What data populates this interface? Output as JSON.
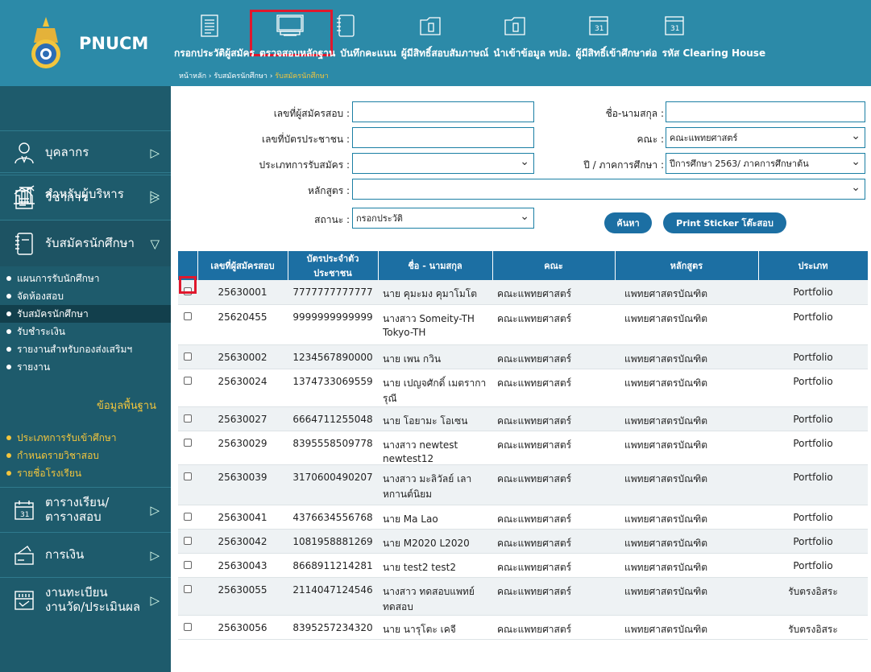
{
  "brand": {
    "name": "PNUCM"
  },
  "sidebar": {
    "menu": [
      {
        "label": "สำหรับผู้บริหาร",
        "icon": "chart-icon"
      },
      {
        "label": "บุคลากร",
        "icon": "person-icon"
      },
      {
        "label": "วิชาการ",
        "icon": "document-icon"
      },
      {
        "label": "รับสมัครนักศึกษา",
        "icon": "notebook-icon"
      }
    ],
    "admission_sub": [
      "แผนการรับนักศึกษา",
      "จัดห้องสอบ",
      "รับสมัครนักศึกษา",
      "รับชำระเงิน",
      "รายงานสำหรับกองส่งเสริมฯ",
      "รายงาน"
    ],
    "master_title": "ข้อมูลพื้นฐาน",
    "master_sub": [
      "ประเภทการรับเข้าศึกษา",
      "กำหนดรายวิชาสอบ",
      "รายชื่อโรงเรียน"
    ],
    "schedule": {
      "line1": "ตารางเรียน/",
      "line2": "ตารางสอบ"
    },
    "finance": "การเงิน",
    "registration": {
      "line1": "งานทะเบียน",
      "line2": "งานวัด/ประเมินผล"
    }
  },
  "topnav": {
    "items": [
      "กรอกประวัติผู้สมัคร",
      "ตรวจสอบหลักฐาน",
      "บันทึกคะแนน",
      "ผู้มีสิทธิ์สอบสัมภาษณ์",
      "นำเข้าข้อมูล ทปอ.",
      "ผู้มีสิทธิ์เข้าศึกษาต่อ",
      "รหัส Clearing House"
    ],
    "breadcrumb": {
      "home": "หน้าหลัก",
      "sep": " › ",
      "level1": "รับสมัครนักศึกษา",
      "current": "รับสมัครนักศึกษา"
    }
  },
  "form": {
    "applicant_no_label": "เลขที่ผู้สมัครสอบ :",
    "name_label": "ชื่อ-นามสกุล :",
    "id_card_label": "เลขที่บัตรประชาชน :",
    "faculty_label": "คณะ :",
    "faculty_value": "คณะแพทยศาสตร์",
    "admission_type_label": "ประเภทการรับสมัคร :",
    "year_label": "ปี / ภาคการศึกษา :",
    "year_value": "ปีการศึกษา 2563/ ภาคการศึกษาต้น",
    "curriculum_label": "หลักสูตร :",
    "status_label": "สถานะ :",
    "status_value": "กรอกประวัติ",
    "search_button": "ค้นหา",
    "sticker_button": "Print Sticker โต๊ะสอบ"
  },
  "table": {
    "headers": [
      "",
      "เลขที่ผู้สมัครสอบ",
      "บัตรประจำตัวประชาชน",
      "ชื่อ - นามสกุล",
      "คณะ",
      "หลักสูตร",
      "ประเภท"
    ],
    "rows": [
      [
        "25630001",
        "7777777777777",
        "นาย คุมะมง คุมาโมโต",
        "คณะแพทยศาสตร์",
        "แพทยศาสตรบัณฑิต",
        "Portfolio"
      ],
      [
        "25620455",
        "9999999999999",
        "นางสาว Someity-TH Tokyo-TH",
        "คณะแพทยศาสตร์",
        "แพทยศาสตรบัณฑิต",
        "Portfolio"
      ],
      [
        "25630002",
        "1234567890000",
        "นาย เพน กวิน",
        "คณะแพทยศาสตร์",
        "แพทยศาสตรบัณฑิต",
        "Portfolio"
      ],
      [
        "25630024",
        "1374733069559",
        "นาย เปญจศักดิ์ เมตราการุณี",
        "คณะแพทยศาสตร์",
        "แพทยศาสตรบัณฑิต",
        "Portfolio"
      ],
      [
        "25630027",
        "6664711255048",
        "นาย โอยามะ โอเซน",
        "คณะแพทยศาสตร์",
        "แพทยศาสตรบัณฑิต",
        "Portfolio"
      ],
      [
        "25630029",
        "8395558509778",
        "นางสาว newtest newtest12",
        "คณะแพทยศาสตร์",
        "แพทยศาสตรบัณฑิต",
        "Portfolio"
      ],
      [
        "25630039",
        "3170600490207",
        "นางสาว มะลิวัลย์ เลาหกานต์นิยม",
        "คณะแพทยศาสตร์",
        "แพทยศาสตรบัณฑิต",
        "Portfolio"
      ],
      [
        "25630041",
        "4376634556768",
        "นาย Ma Lao",
        "คณะแพทยศาสตร์",
        "แพทยศาสตรบัณฑิต",
        "Portfolio"
      ],
      [
        "25630042",
        "1081958881269",
        "นาย M2020 L2020",
        "คณะแพทยศาสตร์",
        "แพทยศาสตรบัณฑิต",
        "Portfolio"
      ],
      [
        "25630043",
        "8668911214281",
        "นาย test2 test2",
        "คณะแพทยศาสตร์",
        "แพทยศาสตรบัณฑิต",
        "Portfolio"
      ],
      [
        "25630055",
        "2114047124546",
        "นางสาว ทดสอบแพทย์ ทดสอบ",
        "คณะแพทยศาสตร์",
        "แพทยศาสตรบัณฑิต",
        "รับตรงอิสระ"
      ],
      [
        "25630056",
        "8395257234320",
        "นาย นารุโตะ เคจี",
        "คณะแพทยศาสตร์",
        "แพทยศาสตรบัณฑิต",
        "รับตรงอิสระ"
      ]
    ]
  },
  "colors": {
    "sidebar": "#1e5b6c",
    "header": "#2c8aa8",
    "accent": "#1c6fa3",
    "highlight": "#e0182d",
    "yellow": "#f2c53d"
  }
}
